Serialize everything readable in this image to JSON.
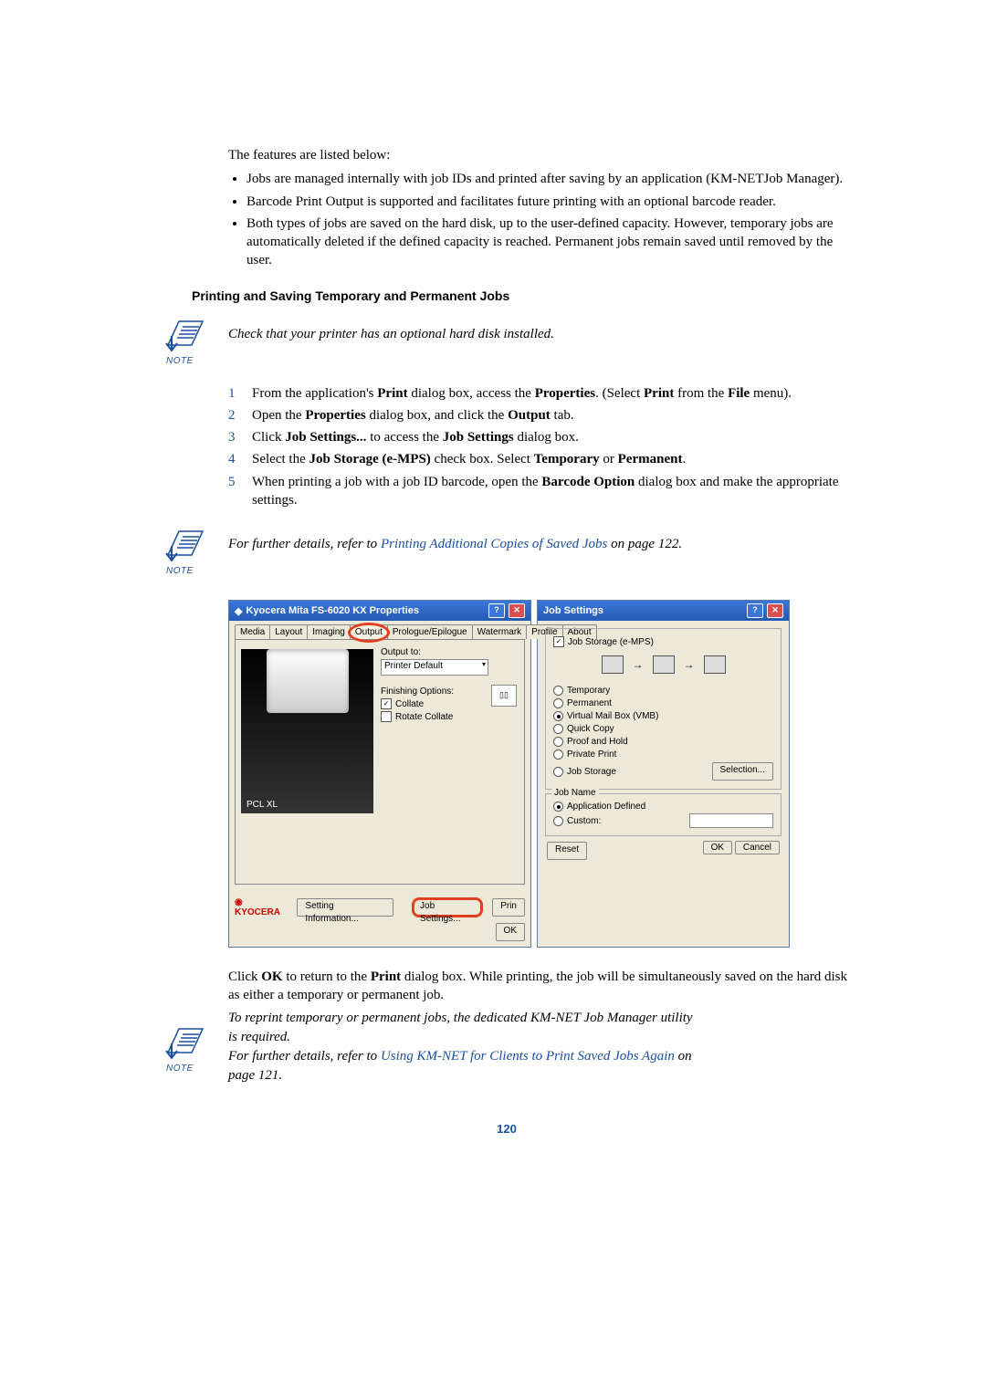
{
  "intro": "The features are listed below:",
  "bullets": [
    "Jobs are managed internally with job IDs and printed after saving by an application (KM-NETJob Manager).",
    "Barcode Print Output is supported and facilitates future printing with an optional barcode reader.",
    "Both types of jobs are saved on the hard disk, up to the user-defined capacity. However, temporary jobs are automatically deleted if the defined capacity is reached. Permanent jobs remain saved until removed by the user."
  ],
  "section_heading": "Printing and Saving Temporary and Permanent Jobs",
  "note_label": "NOTE",
  "note1_text": "Check that your printer has an optional hard disk installed.",
  "steps": [
    {
      "pre": "From the application's ",
      "b1": "Print",
      "mid1": " dialog box, access the ",
      "b2": "Properties",
      "mid2": ". (Select ",
      "b3": "Print",
      "mid3": " from the ",
      "b4": "File",
      "post": " menu)."
    },
    {
      "pre": "Open the ",
      "b1": "Properties",
      "mid1": " dialog box, and click the ",
      "b2": "Output",
      "post": " tab."
    },
    {
      "pre": "Click ",
      "b1": "Job Settings...",
      "mid1": " to access the ",
      "b2": "Job Settings",
      "post": " dialog box."
    },
    {
      "pre": "Select the ",
      "b1": "Job Storage (e-MPS)",
      "mid1": " check box. Select ",
      "b2": "Temporary",
      "mid2": " or ",
      "b3": "Permanent",
      "post": "."
    },
    {
      "pre": "When printing a job with a job ID barcode, open the ",
      "b1": "Barcode Option",
      "mid1": " dialog box and make the appropriate settings.",
      "b2": "",
      "post": ""
    }
  ],
  "note2_pre": "For further details, refer to ",
  "note2_link": "Printing Additional Copies of Saved Jobs",
  "note2_post": " on page 122.",
  "dlg1": {
    "title": "Kyocera Mita FS-6020 KX Properties",
    "tabs": [
      "Media",
      "Layout",
      "Imaging",
      "Output",
      "Prologue/Epilogue",
      "Watermark",
      "Profile",
      "About"
    ],
    "active_tab": "Output",
    "output_to_label": "Output to:",
    "output_to_value": "Printer Default",
    "finishing_label": "Finishing Options:",
    "collate": "Collate",
    "rotate": "Rotate Collate",
    "pcl": "PCL XL",
    "kyo": "KYOCERA",
    "setting_info": "Setting Information...",
    "job_settings": "Job Settings...",
    "print": "Prin",
    "ok": "OK"
  },
  "dlg2": {
    "title": "Job Settings",
    "jobstorage_cb": "Job Storage (e-MPS)",
    "radios": [
      "Temporary",
      "Permanent",
      "Virtual Mail Box (VMB)",
      "Quick Copy",
      "Proof and Hold",
      "Private Print",
      "Job Storage"
    ],
    "selected_radio": 2,
    "selection_btn": "Selection...",
    "jobname_title": "Job Name",
    "appdef": "Application Defined",
    "custom": "Custom:",
    "reset": "Reset",
    "ok": "OK",
    "cancel": "Cancel"
  },
  "after_shot_pre": "Click ",
  "after_shot_b1": "OK",
  "after_shot_mid1": " to return to the ",
  "after_shot_b2": "Print",
  "after_shot_post": " dialog box. While printing, the job will be simultaneously saved on the hard disk as either a temporary or permanent job.",
  "note3_line1": "To reprint temporary or permanent jobs, the dedicated KM-NET Job Manager utility is required.",
  "note3_pre": "For further details, refer to ",
  "note3_link": "Using KM-NET for Clients to Print Saved Jobs Again",
  "note3_post": " on page 121.",
  "page_num": "120"
}
